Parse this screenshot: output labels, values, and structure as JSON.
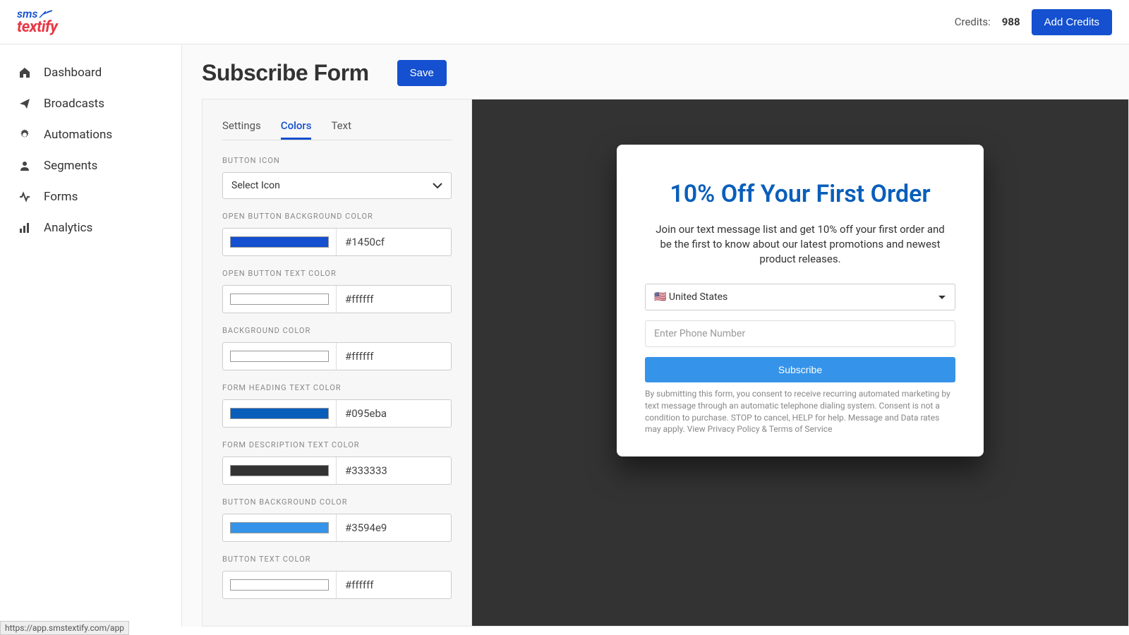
{
  "header": {
    "logo_top": "sms",
    "logo_bottom": "textify",
    "credits_label": "Credits:",
    "credits_value": "988",
    "add_credits": "Add Credits"
  },
  "sidebar": {
    "items": [
      {
        "label": "Dashboard"
      },
      {
        "label": "Broadcasts"
      },
      {
        "label": "Automations"
      },
      {
        "label": "Segments"
      },
      {
        "label": "Forms"
      },
      {
        "label": "Analytics"
      }
    ]
  },
  "page": {
    "title": "Subscribe Form",
    "save": "Save"
  },
  "tabs": {
    "settings": "Settings",
    "colors": "Colors",
    "text": "Text"
  },
  "fields": {
    "button_icon": {
      "label": "BUTTON ICON",
      "value": "Select Icon"
    },
    "open_btn_bg": {
      "label": "OPEN BUTTON BACKGROUND COLOR",
      "value": "#1450cf"
    },
    "open_btn_text": {
      "label": "OPEN BUTTON TEXT COLOR",
      "value": "#ffffff"
    },
    "bg_color": {
      "label": "BACKGROUND COLOR",
      "value": "#ffffff"
    },
    "heading_color": {
      "label": "FORM HEADING TEXT COLOR",
      "value": "#095eba"
    },
    "desc_color": {
      "label": "FORM DESCRIPTION TEXT COLOR",
      "value": "#333333"
    },
    "btn_bg": {
      "label": "BUTTON BACKGROUND COLOR",
      "value": "#3594e9"
    },
    "btn_text": {
      "label": "BUTTON TEXT COLOR",
      "value": "#ffffff"
    }
  },
  "preview": {
    "heading": "10% Off Your First Order",
    "description": "Join our text message list and get 10% off your first order and be the first to know about our latest promotions and newest product releases.",
    "country": "🇺🇸 United States",
    "phone_placeholder": "Enter Phone Number",
    "subscribe": "Subscribe",
    "disclaimer": "By submitting this form, you consent to receive recurring automated marketing by text message through an automatic telephone dialing system. Consent is not a condition to purchase. STOP to cancel, HELP for help. Message and Data rates may apply. View Privacy Policy & Terms of Service"
  },
  "status_url": "https://app.smstextify.com/app"
}
